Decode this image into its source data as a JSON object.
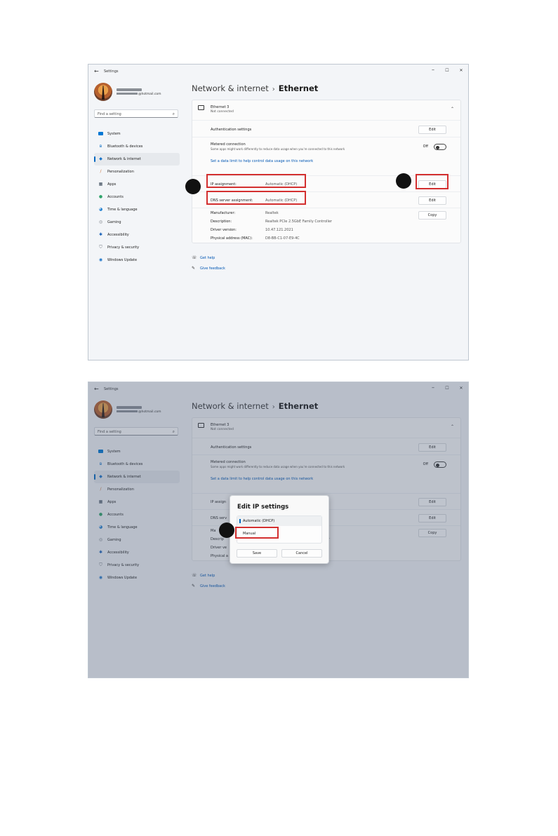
{
  "window": {
    "title": "Settings",
    "back_glyph": "←",
    "controls": {
      "minimize": "–",
      "maximize": "☐",
      "close": "✕"
    }
  },
  "user": {
    "email_suffix": "@hotmail.com"
  },
  "search": {
    "placeholder": "Find a setting",
    "icon": "search-icon"
  },
  "nav": [
    {
      "label": "System",
      "icon": "monitor-icon",
      "color": "#0078d4"
    },
    {
      "label": "Bluetooth & devices",
      "icon": "bluetooth-icon",
      "color": "#0067c0"
    },
    {
      "label": "Network & internet",
      "icon": "wifi-icon",
      "color": "#1a73c8",
      "selected": true
    },
    {
      "label": "Personalization",
      "icon": "brush-icon",
      "color": "#c9733a"
    },
    {
      "label": "Apps",
      "icon": "apps-icon",
      "color": "#3b4a5a"
    },
    {
      "label": "Accounts",
      "icon": "person-icon",
      "color": "#2ea36a"
    },
    {
      "label": "Time & language",
      "icon": "globe-clock-icon",
      "color": "#1f7fd0"
    },
    {
      "label": "Gaming",
      "icon": "gamepad-icon",
      "color": "#7a8088"
    },
    {
      "label": "Accessibility",
      "icon": "accessibility-icon",
      "color": "#1a62b8"
    },
    {
      "label": "Privacy & security",
      "icon": "shield-icon",
      "color": "#6a7078"
    },
    {
      "label": "Windows Update",
      "icon": "update-icon",
      "color": "#1a73c8"
    }
  ],
  "breadcrumb": {
    "parent": "Network & internet",
    "separator": "›",
    "current": "Ethernet"
  },
  "adapter": {
    "name": "Ethernet 3",
    "status": "Not connected",
    "chevron": "⌃"
  },
  "settings": {
    "auth_label": "Authentication settings",
    "metered_label": "Metered connection",
    "metered_desc": "Some apps might work differently to reduce data usage when you're connected to this network",
    "metered_state": "Off",
    "data_limit_link": "Set a data limit to help control data usage on this network",
    "ip_label": "IP assignment:",
    "ip_value": "Automatic (DHCP)",
    "dns_label": "DNS server assignment:",
    "dns_value": "Automatic (DHCP)",
    "edit": "Edit",
    "copy": "Copy"
  },
  "properties": [
    {
      "label": "Manufacturer:",
      "value": "Realtek"
    },
    {
      "label": "Description:",
      "value": "Realtek PCIe 2.5GbE Family Controller"
    },
    {
      "label": "Driver version:",
      "value": "10.47.121.2021"
    },
    {
      "label": "Physical address (MAC):",
      "value": "D8-BB-C1-07-E9-4C"
    }
  ],
  "help": {
    "get_help": "Get help",
    "feedback": "Give feedback"
  },
  "dialog": {
    "title": "Edit IP settings",
    "options": [
      "Automatic (DHCP)",
      "Manual"
    ],
    "save": "Save",
    "cancel": "Cancel"
  },
  "covered_fragments": {
    "ip": "IP assign",
    "dns": "DNS serv",
    "manufacturer": "Ma",
    "description": "Descrip",
    "driver": "Driver ve",
    "physical": "Physical a",
    "description_tail": "oller"
  },
  "colors": {
    "accent": "#0067c0",
    "highlight": "#d32f2f",
    "link": "#0056b3"
  }
}
